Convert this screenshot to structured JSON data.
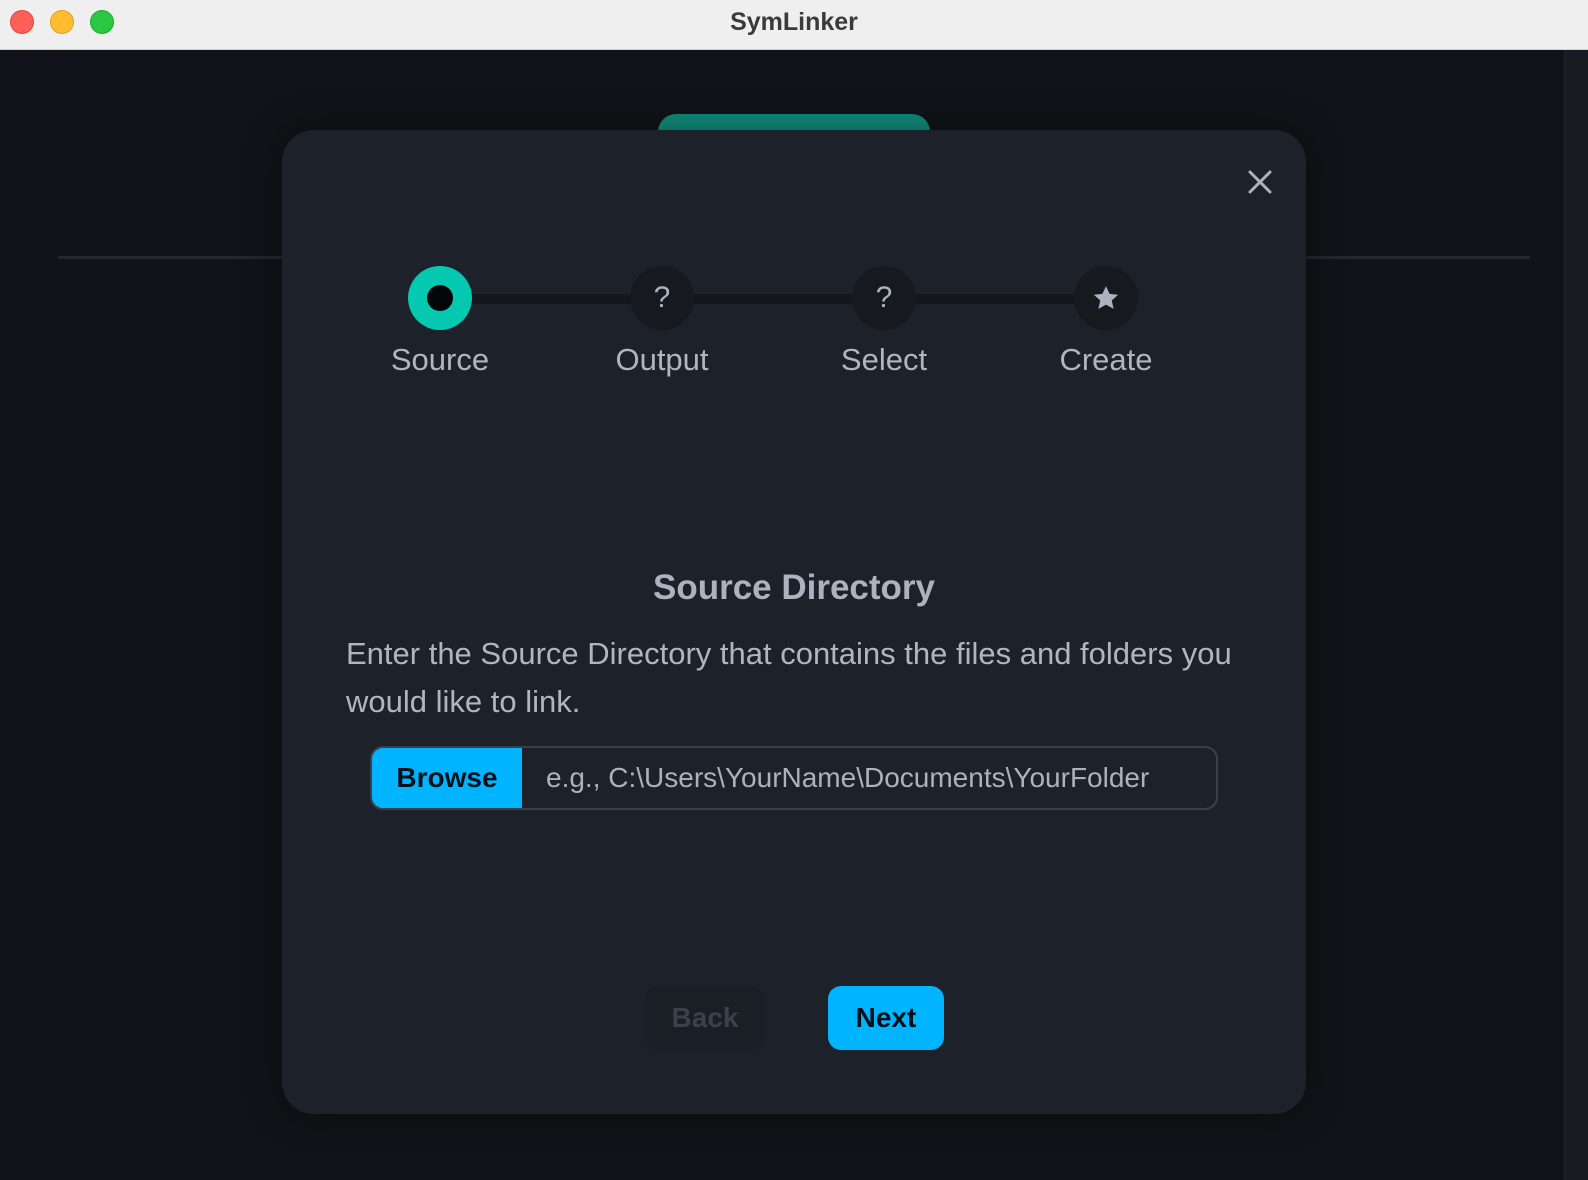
{
  "window": {
    "title": "SymLinker"
  },
  "stepper": {
    "steps": [
      {
        "label": "Source",
        "state": "active"
      },
      {
        "label": "Output",
        "symbol": "?",
        "state": "pending"
      },
      {
        "label": "Select",
        "symbol": "?",
        "state": "pending"
      },
      {
        "label": "Create",
        "symbol": "star-icon",
        "state": "pending"
      }
    ]
  },
  "content": {
    "heading": "Source Directory",
    "description": "Enter the Source Directory that contains the files and folders you would like to link.",
    "browse_label": "Browse",
    "path_value": "",
    "path_placeholder": "e.g., C:\\Users\\YourName\\Documents\\YourFolder"
  },
  "footer": {
    "back_label": "Back",
    "back_disabled": true,
    "next_label": "Next"
  },
  "colors": {
    "accent": "#00b4ff",
    "step_active": "#05c8b0",
    "modal_bg": "#1d222a"
  },
  "icons": {
    "close": "close-icon",
    "create_step": "star-icon"
  }
}
